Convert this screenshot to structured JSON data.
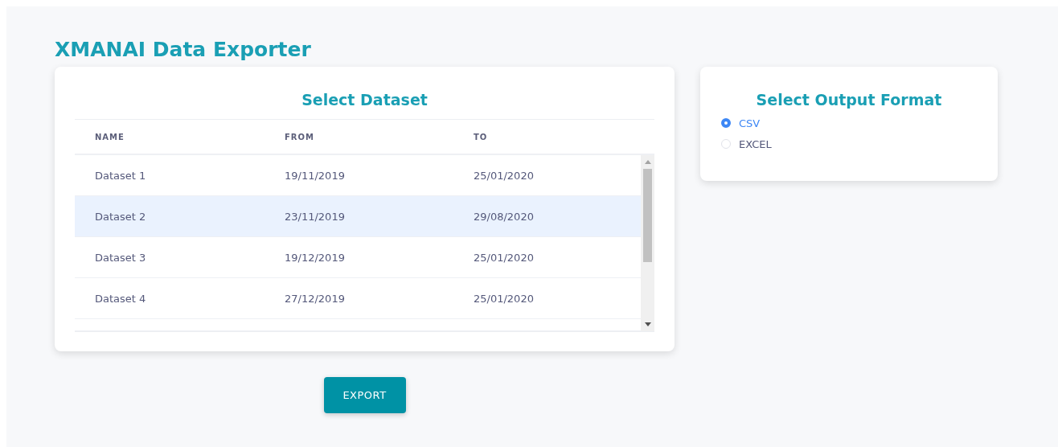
{
  "title": "XMANAI Data Exporter",
  "dataset_panel": {
    "title": "Select Dataset",
    "columns": [
      "NAME",
      "FROM",
      "TO"
    ],
    "rows": [
      {
        "cells": [
          "Dataset 1",
          "19/11/2019",
          "25/01/2020"
        ],
        "selected": false
      },
      {
        "cells": [
          "Dataset 2",
          "23/11/2019",
          "29/08/2020"
        ],
        "selected": true
      },
      {
        "cells": [
          "Dataset 3",
          "19/12/2019",
          "25/01/2020"
        ],
        "selected": false
      },
      {
        "cells": [
          "Dataset 4",
          "27/12/2019",
          "25/01/2020"
        ],
        "selected": false
      }
    ]
  },
  "format_panel": {
    "title": "Select Output Format",
    "options": [
      {
        "label": "CSV",
        "selected": true
      },
      {
        "label": "EXCEL",
        "selected": false
      }
    ]
  },
  "export_button": "EXPORT"
}
